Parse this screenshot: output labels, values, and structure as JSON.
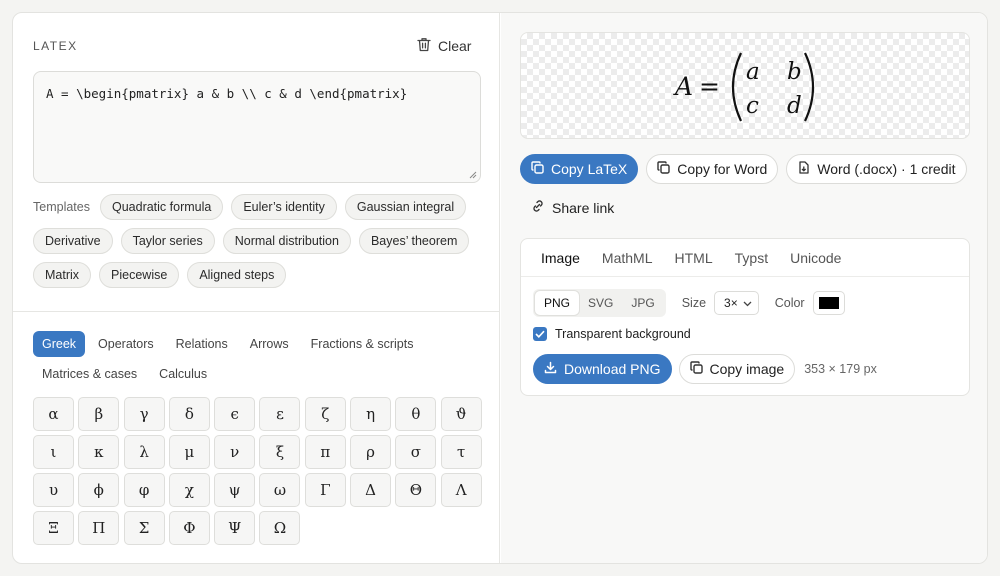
{
  "editor": {
    "label": "LATEX",
    "clear_label": "Clear",
    "value": "A = \\begin{pmatrix} a & b \\\\ c & d \\end{pmatrix}"
  },
  "templates": {
    "label": "Templates",
    "items": [
      "Quadratic formula",
      "Euler’s identity",
      "Gaussian integral",
      "Derivative",
      "Taylor series",
      "Normal distribution",
      "Bayes’ theorem",
      "Matrix",
      "Piecewise",
      "Aligned steps"
    ]
  },
  "symbols": {
    "categories": [
      "Greek",
      "Operators",
      "Relations",
      "Arrows",
      "Fractions & scripts",
      "Matrices & cases",
      "Calculus"
    ],
    "active_category": "Greek",
    "greek": [
      "α",
      "β",
      "γ",
      "δ",
      "ϵ",
      "ε",
      "ζ",
      "η",
      "θ",
      "ϑ",
      "ι",
      "κ",
      "λ",
      "μ",
      "ν",
      "ξ",
      "π",
      "ρ",
      "σ",
      "τ",
      "υ",
      "ϕ",
      "φ",
      "χ",
      "ψ",
      "ω",
      "Γ",
      "Δ",
      "Θ",
      "Λ",
      "Ξ",
      "Π",
      "Σ",
      "Φ",
      "Ψ",
      "Ω"
    ]
  },
  "preview": {
    "lhs": "A",
    "equals": "=",
    "matrix": [
      [
        "a",
        "b"
      ],
      [
        "c",
        "d"
      ]
    ]
  },
  "actions": {
    "copy_latex": "Copy LaTeX",
    "copy_word": "Copy for Word",
    "word_docx": "Word (.docx) · 1 credit",
    "share_link": "Share link"
  },
  "export": {
    "tabs": [
      "Image",
      "MathML",
      "HTML",
      "Typst",
      "Unicode"
    ],
    "active_tab": "Image",
    "formats": [
      "PNG",
      "SVG",
      "JPG"
    ],
    "active_format": "PNG",
    "size_label": "Size",
    "size_value": "3×",
    "color_label": "Color",
    "color_value": "#000000",
    "transparent_label": "Transparent background",
    "transparent_checked": true,
    "download_label": "Download PNG",
    "copy_image_label": "Copy image",
    "dimensions": "353 × 179 px"
  },
  "colors": {
    "accent": "#3a78c2"
  }
}
